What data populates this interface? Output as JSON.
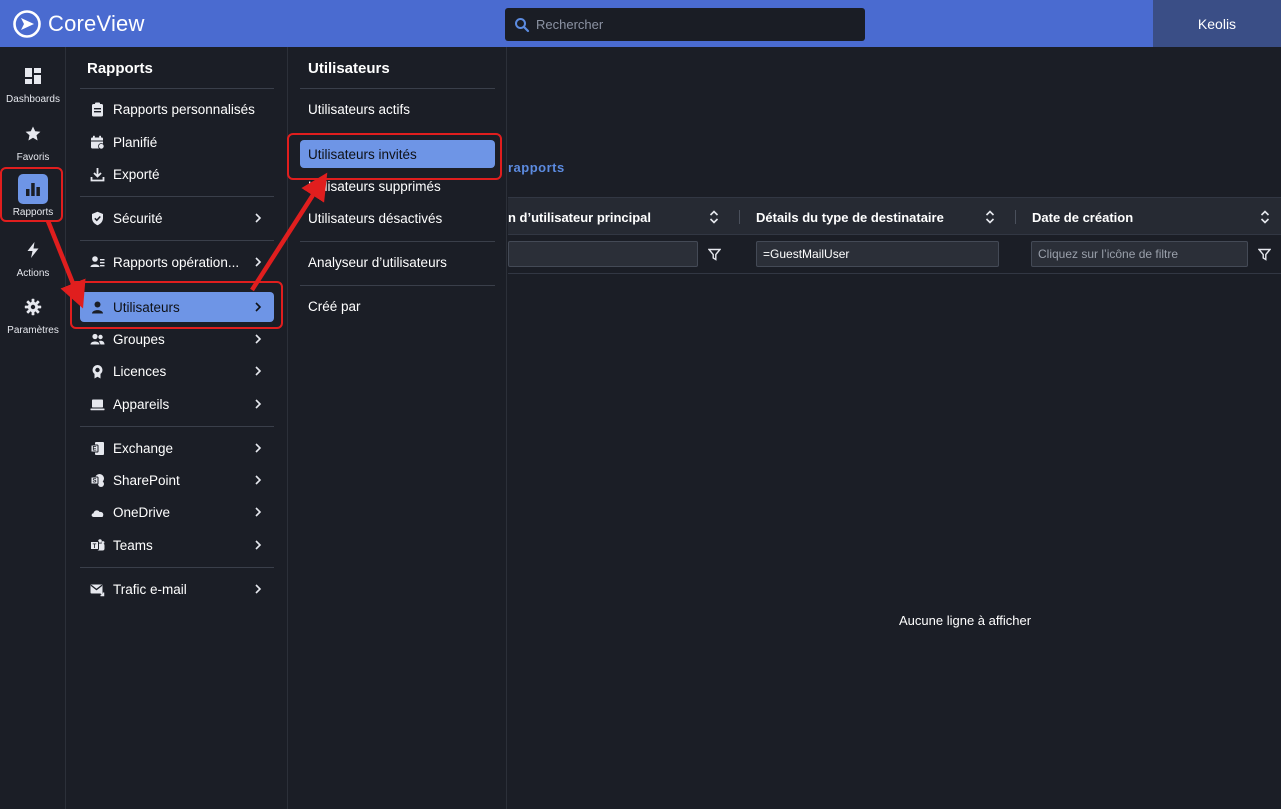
{
  "topbar": {
    "brand": "CoreView",
    "search_placeholder": "Rechercher",
    "tenant": "Keolis"
  },
  "rail": {
    "items": [
      {
        "label": "Dashboards",
        "icon": "dashboard-icon"
      },
      {
        "label": "Favoris",
        "icon": "star-icon"
      },
      {
        "label": "Rapports",
        "icon": "bar-chart-icon"
      },
      {
        "label": "Actions",
        "icon": "bolt-icon"
      },
      {
        "label": "Paramètres",
        "icon": "gear-icon"
      }
    ]
  },
  "menu_reports": {
    "title": "Rapports",
    "items": [
      {
        "label": "Rapports personnalisés",
        "icon": "clipboard-icon"
      },
      {
        "label": "Planifié",
        "icon": "calendar-clock-icon"
      },
      {
        "label": "Exporté",
        "icon": "download-icon"
      },
      {
        "label": "Sécurité",
        "icon": "shield-icon"
      },
      {
        "label": "Rapports opération...",
        "icon": "user-list-icon"
      },
      {
        "label": "Utilisateurs",
        "icon": "user-icon"
      },
      {
        "label": "Groupes",
        "icon": "group-icon"
      },
      {
        "label": "Licences",
        "icon": "license-icon"
      },
      {
        "label": "Appareils",
        "icon": "laptop-icon"
      },
      {
        "label": "Exchange",
        "icon": "exchange-icon"
      },
      {
        "label": "SharePoint",
        "icon": "sharepoint-icon"
      },
      {
        "label": "OneDrive",
        "icon": "cloud-icon"
      },
      {
        "label": "Teams",
        "icon": "teams-icon"
      },
      {
        "label": "Trafic e-mail",
        "icon": "mail-icon"
      }
    ]
  },
  "menu_users": {
    "title": "Utilisateurs",
    "items": [
      {
        "label": "Utilisateurs actifs"
      },
      {
        "label": "Utilisateurs invités"
      },
      {
        "label": "Utilisateurs supprimés"
      },
      {
        "label": "Utilisateurs désactivés"
      },
      {
        "label": "Analyseur d’utilisateurs"
      },
      {
        "label": "Créé par"
      }
    ]
  },
  "main": {
    "link_fragment": "rapports",
    "columns": [
      {
        "label": "n d’utilisateur principal"
      },
      {
        "label": "Détails du type de destinataire"
      },
      {
        "label": "Date de création"
      }
    ],
    "filters": [
      {
        "value": "",
        "placeholder": ""
      },
      {
        "value": "=GuestMailUser",
        "placeholder": ""
      },
      {
        "value": "",
        "placeholder": "Cliquez sur l’icône de filtre"
      }
    ],
    "empty_message": "Aucune ligne à afficher"
  },
  "colors": {
    "topbar": "#4a6bd0",
    "tenant_bg": "#3a4e86",
    "selected": "#6e95e6",
    "background": "#1b1e26",
    "annotation": "#e01e1e",
    "link": "#5c8be0"
  }
}
